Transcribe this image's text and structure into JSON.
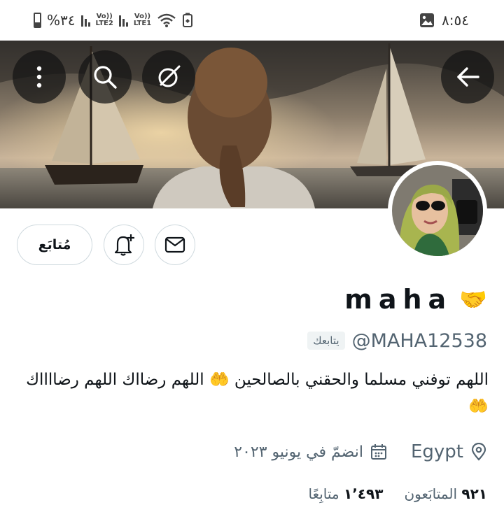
{
  "status_bar": {
    "battery_text": "%٣٤",
    "sim2_label": "LTE2",
    "sim1_label": "LTE1",
    "volte_label": "Vo))",
    "time": "٨:٥٤"
  },
  "banner": {
    "icons": [
      "more-icon",
      "search-icon",
      "grok-icon",
      "back-arrow-icon"
    ]
  },
  "actions": {
    "follow_label": "مُتابَع"
  },
  "profile": {
    "display_name": "maha",
    "name_emoji": "🤝",
    "handle": "@MAHA12538",
    "follows_you": "يتابعك",
    "bio_text": "اللهم توفني مسلما والحقني بالصالحين",
    "bio_text_2": "اللهم رضااك اللهم رضااااك",
    "bio_emoji": "🤲",
    "location": "Egypt",
    "joined": "انضمّ في يونيو ٢٠٢٣"
  },
  "stats": {
    "following_count": "٩٢١",
    "following_label": "المتابَعون",
    "followers_count": "١٬٤٩٣",
    "followers_label": "متابِعًا"
  },
  "colors": {
    "accent_dark": "#0f1419",
    "muted": "#536471",
    "border": "#cfd9de"
  }
}
